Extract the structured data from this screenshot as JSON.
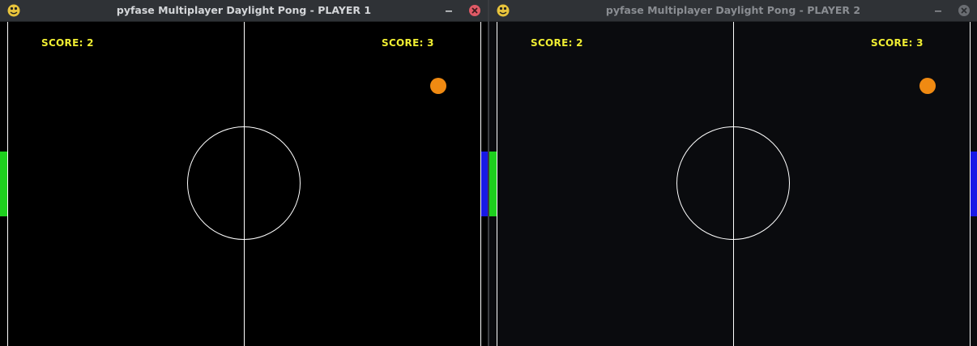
{
  "windows": [
    {
      "title": "pyfase Multiplayer Daylight Pong - PLAYER 1",
      "score_left": "SCORE: 2",
      "score_right": "SCORE: 3"
    },
    {
      "title": "pyfase Multiplayer Daylight Pong - PLAYER 2",
      "score_left": "SCORE: 2",
      "score_right": "SCORE: 3"
    }
  ],
  "colors": {
    "score": "#f0ee32",
    "ball": "#f08a12",
    "paddle_player1": "#1ed01e",
    "paddle_player2": "#1818e6",
    "lines": "#ffffff",
    "close_button": "#e05a66"
  },
  "icons": {
    "app": "python-snake-icon",
    "minimize": "minimize-icon",
    "close": "close-icon"
  }
}
